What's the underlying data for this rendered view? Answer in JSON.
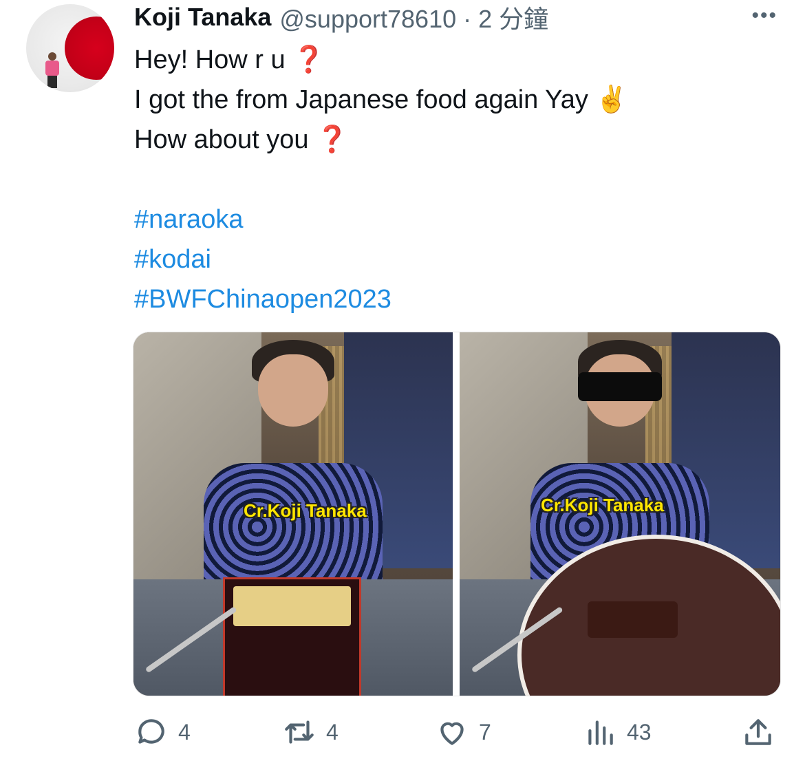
{
  "tweet": {
    "author_name": "Koji Tanaka",
    "handle_time": "@support78610 · 2 分鐘",
    "more_icon": "more-horizontal-icon",
    "lines": [
      {
        "text": "Hey! How r u ",
        "emoji": "❓"
      },
      {
        "text": "I got the from Japanese food again Yay ",
        "emoji": "✌️"
      },
      {
        "text": "How about you ",
        "emoji": "❓"
      }
    ],
    "hashtags": [
      "#naraoka",
      "#kodai",
      "#BWFChinaopen2023"
    ]
  },
  "media": {
    "left_caption": "Cr.Koji Tanaka",
    "right_caption": "Cr.Koji Tanaka"
  },
  "actions": {
    "reply_count": "4",
    "retweet_count": "4",
    "like_count": "7",
    "views_count": "43"
  },
  "colors": {
    "text": "#0f1419",
    "secondary": "#536471",
    "hashtag": "#1d8be1",
    "caption": "#ffe600"
  }
}
